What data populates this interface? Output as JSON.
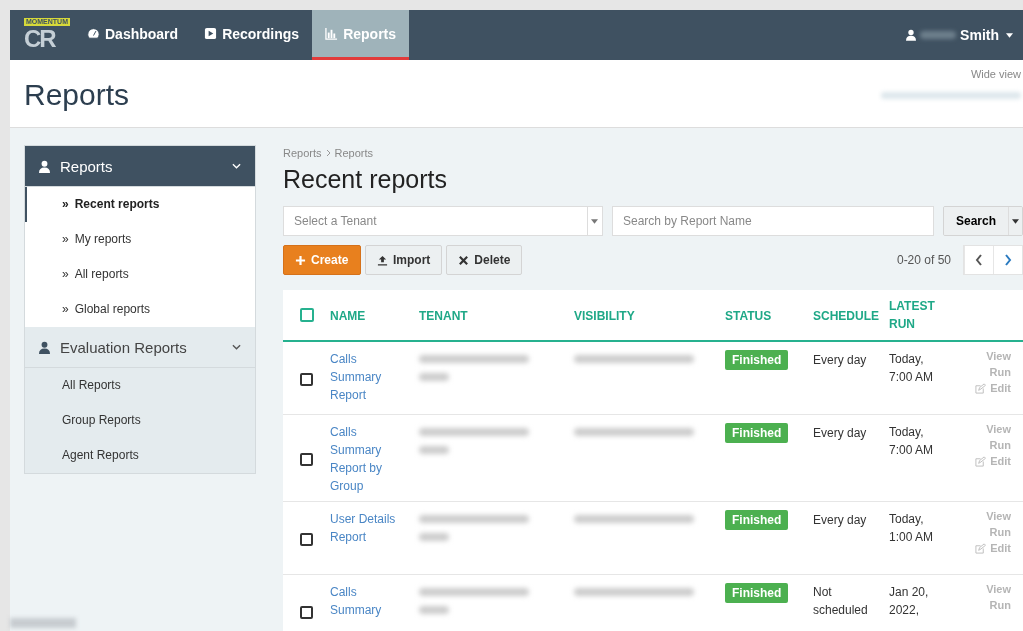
{
  "navbar": {
    "logo": {
      "badge": "MOMENTUM",
      "letters": "CR"
    },
    "tabs": [
      {
        "label": "Dashboard",
        "selected": false
      },
      {
        "label": "Recordings",
        "selected": false
      },
      {
        "label": "Reports",
        "selected": true
      }
    ],
    "user": {
      "name": "Smith"
    }
  },
  "header": {
    "title": "Reports",
    "wide_view": "Wide view"
  },
  "sidebar": {
    "sections": [
      {
        "title": "Reports",
        "active": true,
        "items": [
          {
            "bullet": "»",
            "label": "Recent reports",
            "selected": true
          },
          {
            "bullet": "»",
            "label": "My reports",
            "selected": false
          },
          {
            "bullet": "»",
            "label": "All reports",
            "selected": false
          },
          {
            "bullet": "»",
            "label": "Global reports",
            "selected": false
          }
        ]
      },
      {
        "title": "Evaluation Reports",
        "active": false,
        "items": [
          {
            "label": "All Reports",
            "selected": false
          },
          {
            "label": "Group Reports",
            "selected": false
          },
          {
            "label": "Agent Reports",
            "selected": false
          }
        ]
      }
    ]
  },
  "content": {
    "breadcrumb": [
      "Reports",
      "Reports"
    ],
    "title": "Recent reports",
    "tenant_select": {
      "placeholder": "Select a Tenant"
    },
    "search": {
      "placeholder": "Search by Report Name",
      "button": "Search"
    },
    "buttons": [
      {
        "kind": "create",
        "label": "Create"
      },
      {
        "kind": "import",
        "label": "Import"
      },
      {
        "kind": "delete",
        "label": "Delete"
      }
    ],
    "pager": "0-20 of 50",
    "table": {
      "all_checked": false,
      "columns": [
        "NAME",
        "TENANT",
        "VISIBILITY",
        "STATUS",
        "SCHEDULE",
        "LATEST RUN"
      ],
      "rows": [
        {
          "checked": false,
          "name": "Calls Summary Report",
          "status": "Finished",
          "schedule": "Every day",
          "latest_run": "Today, 7:00 AM",
          "actions": [
            "View",
            "Run",
            "Edit"
          ]
        },
        {
          "checked": false,
          "name": "Calls Summary Report by Group",
          "status": "Finished",
          "schedule": "Every day",
          "latest_run": "Today, 7:00 AM",
          "actions": [
            "View",
            "Run",
            "Edit"
          ]
        },
        {
          "checked": false,
          "name": "User Details Report",
          "status": "Finished",
          "schedule": "Every day",
          "latest_run": "Today, 1:00 AM",
          "actions": [
            "View",
            "Run",
            "Edit"
          ]
        },
        {
          "checked": false,
          "name": "Calls Summary",
          "status": "Finished",
          "schedule": "Not scheduled",
          "latest_run": "Jan 20, 2022,",
          "actions": [
            "View",
            "Run"
          ]
        }
      ]
    }
  }
}
